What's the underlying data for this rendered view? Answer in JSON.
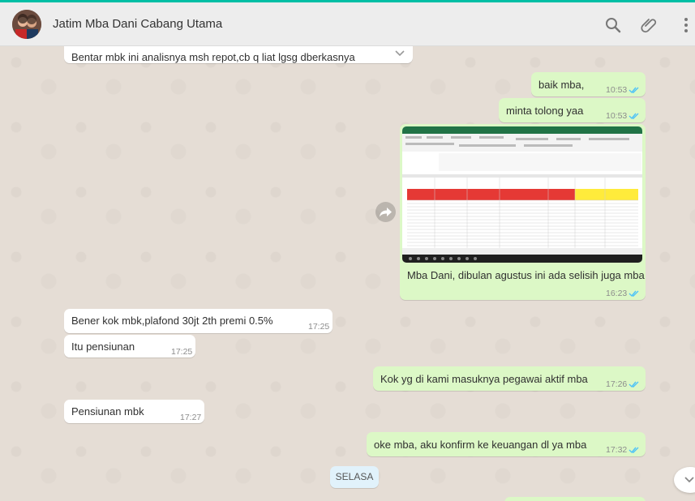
{
  "header": {
    "contact_name": "Jatim Mba Dani Cabang Utama",
    "icons": [
      "search-icon",
      "attach-icon",
      "menu-icon"
    ]
  },
  "colors": {
    "incoming": "#ffffff",
    "outgoing": "#dcf8c6",
    "read_tick": "#4fc3f7",
    "top_accent": "#00bfa5"
  },
  "messages": [
    {
      "dir": "in",
      "text": "Bentar mbk ini analisnya msh repot,cb q liat lgsg dberkasnya",
      "time": ""
    },
    {
      "dir": "out",
      "text": "baik mba,",
      "time": "10:53"
    },
    {
      "dir": "out",
      "text": "minta tolong yaa",
      "time": "10:53"
    },
    {
      "dir": "out",
      "text": "Mba Dani, dibulan agustus ini ada selisih juga mba",
      "time": "16:23",
      "has_image": true
    },
    {
      "dir": "in",
      "text": "Bener kok mbk,plafond 30jt 2th premi 0.5%",
      "time": "17:25"
    },
    {
      "dir": "in",
      "text": "Itu pensiunan",
      "time": "17:25"
    },
    {
      "dir": "out",
      "text": "Kok yg di kami masuknya pegawai aktif mba",
      "time": "17:26"
    },
    {
      "dir": "in",
      "text": "Pensiunan mbk",
      "time": "17:27"
    },
    {
      "dir": "out",
      "text": "oke mba, aku konfirm ke keuangan dl ya mba",
      "time": "17:32"
    }
  ],
  "day_separator": "SELASA"
}
